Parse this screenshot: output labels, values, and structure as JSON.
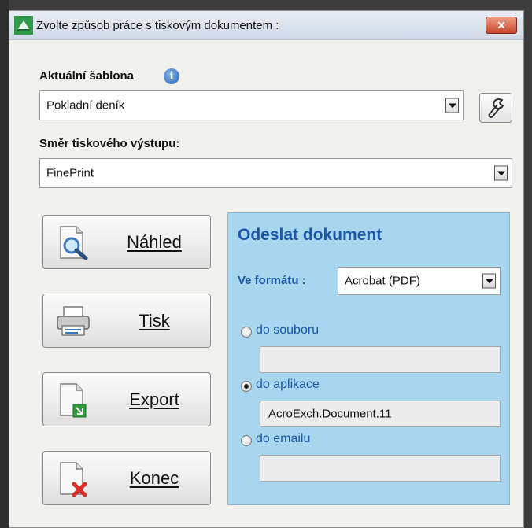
{
  "window": {
    "title": "Zvolte způsob práce s tiskovým dokumentem :",
    "close_label": "✕"
  },
  "template": {
    "label": "Aktuální šablona",
    "value": "Pokladní deník"
  },
  "output": {
    "label": "Směr tiskového výstupu:",
    "value": "FinePrint"
  },
  "buttons": {
    "preview": "Náhled",
    "print": "Tisk",
    "export": "Export",
    "close": "Konec"
  },
  "send": {
    "title": "Odeslat dokument",
    "format_label": "Ve formátu :",
    "format_value": "Acrobat (PDF)",
    "options": [
      {
        "label": "do souboru",
        "value": "",
        "selected": false
      },
      {
        "label": "do aplikace",
        "value": "AcroExch.Document.11",
        "selected": true
      },
      {
        "label": "do emailu",
        "value": "",
        "selected": false
      }
    ]
  },
  "icons": {
    "app": "printer-shortcut-icon",
    "info": "info-icon",
    "wrench": "wrench-icon",
    "preview": "magnifier-document-icon",
    "print": "printer-icon",
    "export": "document-export-icon",
    "close": "document-delete-icon"
  },
  "colors": {
    "panel_bg": "#a8d6ef",
    "accent_text": "#1d58a6",
    "window_bg": "#f0f0ec"
  }
}
